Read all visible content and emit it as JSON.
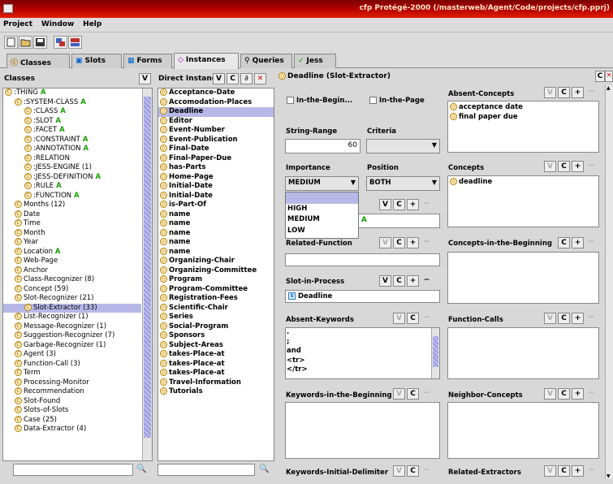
{
  "window": {
    "title": "cfp  Protégé-2000   (/masterweb/Agent/Code/projects/cfp.pprj)"
  },
  "menu": [
    "Project",
    "Window",
    "Help"
  ],
  "tabs": [
    {
      "label": "Classes",
      "icon": "classes-icon"
    },
    {
      "label": "Slots",
      "icon": "slots-icon"
    },
    {
      "label": "Forms",
      "icon": "forms-icon"
    },
    {
      "label": "Instances",
      "icon": "instances-icon"
    },
    {
      "label": "Queries",
      "icon": "queries-icon"
    },
    {
      "label": "Jess",
      "icon": "jess-check-icon"
    }
  ],
  "active_tab": "Instances",
  "classes_panel": {
    "header": "Classes",
    "btn_v": "V",
    "items": [
      {
        "label": ":THING",
        "badge": "A"
      },
      {
        "label": ":SYSTEM-CLASS",
        "badge": "A"
      },
      {
        "label": ":CLASS",
        "badge": "A"
      },
      {
        "label": ":SLOT",
        "badge": "A"
      },
      {
        "label": ":FACET",
        "badge": "A"
      },
      {
        "label": ":CONSTRAINT",
        "badge": "A"
      },
      {
        "label": ":ANNOTATION",
        "badge": "A"
      },
      {
        "label": ":RELATION",
        "badge": ""
      },
      {
        "label": ":JESS-ENGINE  (1)",
        "badge": ""
      },
      {
        "label": ":JESS-DEFINITION",
        "badge": "A"
      },
      {
        "label": ":RULE",
        "badge": "A"
      },
      {
        "label": ":FUNCTION",
        "badge": "A"
      },
      {
        "label": "Months  (12)",
        "badge": ""
      },
      {
        "label": "Date",
        "badge": ""
      },
      {
        "label": "Time",
        "badge": ""
      },
      {
        "label": "Month",
        "badge": ""
      },
      {
        "label": "Year",
        "badge": ""
      },
      {
        "label": "Location",
        "badge": "A"
      },
      {
        "label": "Web-Page",
        "badge": ""
      },
      {
        "label": "Anchor",
        "badge": ""
      },
      {
        "label": "Class-Recognizer  (8)",
        "badge": ""
      },
      {
        "label": "Concept  (59)",
        "badge": ""
      },
      {
        "label": "Slot-Recognizer  (21)",
        "badge": ""
      },
      {
        "label": "Slot-Extractor  (33)",
        "badge": ""
      },
      {
        "label": "List-Recognizer  (1)",
        "badge": ""
      },
      {
        "label": "Message-Recognizer  (1)",
        "badge": ""
      },
      {
        "label": "Suggestion-Recognizer  (7)",
        "badge": ""
      },
      {
        "label": "Garbage-Recognizer  (1)",
        "badge": ""
      },
      {
        "label": "Agent  (3)",
        "badge": ""
      },
      {
        "label": "Function-Call  (3)",
        "badge": ""
      },
      {
        "label": "Term",
        "badge": ""
      },
      {
        "label": "Processing-Monitor",
        "badge": ""
      },
      {
        "label": "Recommendation",
        "badge": ""
      },
      {
        "label": "Slot-Found",
        "badge": ""
      },
      {
        "label": "Slots-of-Slots",
        "badge": ""
      },
      {
        "label": "Case  (25)",
        "badge": ""
      },
      {
        "label": "Data-Extractor  (4)",
        "badge": ""
      }
    ]
  },
  "instances_panel": {
    "header": "Direct Instances",
    "btn_v": "V",
    "btn_c": "C",
    "btn_x": "✕",
    "items": [
      "Acceptance-Date",
      "Accomodation-Places",
      "Deadline",
      "Editor",
      "Event-Number",
      "Event-Publication",
      "Final-Date",
      "Final-Paper-Due",
      "has-Parts",
      "Home-Page",
      "Initial-Date",
      "Initial-Date",
      "is-Part-Of",
      "name",
      "name",
      "name",
      "name",
      "name",
      "Organizing-Chair",
      "Organizing-Committee",
      "Program",
      "Program-Committee",
      "Registration-Fees",
      "Scientific-Chair",
      "Series",
      "Social-Program",
      "Sponsors",
      "Subject-Areas",
      "takes-Place-at",
      "takes-Place-at",
      "takes-Place-at",
      "Travel-Information",
      "Tutorials"
    ],
    "selected": "Deadline"
  },
  "form": {
    "header": "Deadline (Slot-Extractor)",
    "in_the_begin": "In-the-Begin...",
    "in_the_page": "In-the-Page",
    "string_range_label": "String-Range",
    "string_range_value": "60",
    "criteria_label": "Criteria",
    "importance_label": "Importance",
    "importance_value": "MEDIUM",
    "importance_options": [
      "",
      "HIGH",
      "MEDIUM",
      "LOW"
    ],
    "position_label": "Position",
    "position_value": "BOTH",
    "related_function_label": "Related-Function",
    "slot_in_process_label": "Slot-in-Process",
    "slot_in_process_value": "Deadline",
    "absent_keywords_label": "Absent-Keywords",
    "absent_keywords_items": [
      ".",
      ";",
      "and",
      "<tr>",
      "</tr>"
    ],
    "keywords_begin_label": "Keywords-in-the-Beginning",
    "keywords_initial_label": "Keywords-Initial-Delimiter",
    "absent_concepts_label": "Absent-Concepts",
    "absent_concepts_items": [
      "acceptance date",
      "final paper due"
    ],
    "concepts_label": "Concepts",
    "concepts_items": [
      "deadline"
    ],
    "concepts_begin_label": "Concepts-in-the-Beginning",
    "function_calls_label": "Function-Calls",
    "neighbor_concepts_label": "Neighbor-Concepts",
    "related_extractors_label": "Related-Extractors",
    "partial_badge": "A"
  },
  "colors": {
    "accent": "#b8b8e8",
    "titlebar": "#b30000",
    "badge": "#16a000"
  }
}
